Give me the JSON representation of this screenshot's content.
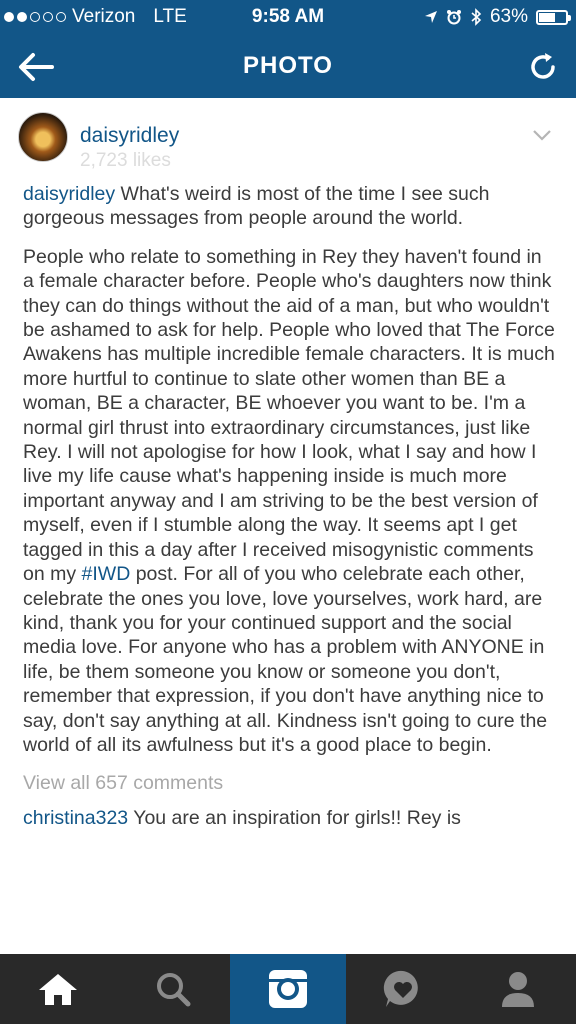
{
  "status_bar": {
    "carrier": "Verizon",
    "network": "LTE",
    "time": "9:58 AM",
    "battery": "63%",
    "battery_level": 0.63
  },
  "nav": {
    "title": "PHOTO",
    "back_icon": "arrow-left-icon",
    "refresh_icon": "refresh-icon"
  },
  "post": {
    "username": "daisyridley",
    "likes_ghost": "2,723 likes",
    "caption": {
      "user": "daisyridley",
      "p1": "What's weird is most of the time I see such gorgeous messages from people around the world.",
      "p2_before": "People who relate to something in Rey they haven't found in a female character before. People who's daughters now think they can do things without the aid of a man, but who wouldn't be ashamed to ask for help. People who loved that The Force Awakens has multiple incredible female characters. It is much more hurtful to continue to slate other women than BE a woman, BE a character, BE whoever you want to be. I'm a normal girl thrust into extraordinary circumstances, just like Rey. I will not apologise for how I look, what I say and how I live my life cause what's happening inside is much more important anyway and I am striving to be the best version of myself, even if I stumble along the way. It seems apt I get tagged in this a day after I received misogynistic comments on my",
      "hashtag": "#IWD",
      "p2_after": "post. For all of you who celebrate each other, celebrate the ones you love, love yourselves, work hard, are kind, thank you for your continued support and the social media love. For anyone who has a problem with ANYONE in life, be them someone you know or someone you don't, remember that expression, if you don't have anything nice to say, don't say anything at all. Kindness isn't going to cure the world of all its awfulness but it's a good place to begin."
    },
    "view_all": "View all 657 comments",
    "comment": {
      "user": "christina323",
      "text": "You are an inspiration for girls!! Rey is"
    }
  },
  "tabs": [
    {
      "icon": "home-icon"
    },
    {
      "icon": "search-icon"
    },
    {
      "icon": "camera-icon"
    },
    {
      "icon": "activity-heart-icon"
    },
    {
      "icon": "profile-icon"
    }
  ],
  "colors": {
    "brand": "#125688",
    "tabbar": "#292929"
  }
}
